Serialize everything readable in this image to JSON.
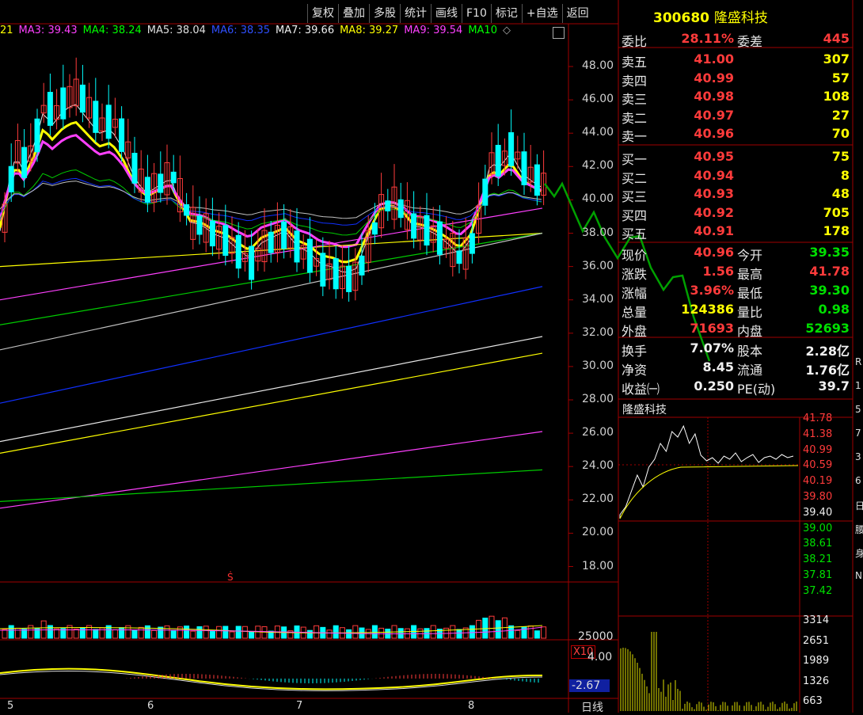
{
  "toolbar": [
    "复权",
    "叠加",
    "多股",
    "统计",
    "画线",
    "F10",
    "标记",
    "+自选",
    "返回"
  ],
  "stock": {
    "code": "300680",
    "name": "隆盛科技"
  },
  "ma_legend": [
    {
      "label": "21",
      "color": "#ffff00"
    },
    {
      "label": "MA3: 39.43",
      "color": "#ff40ff"
    },
    {
      "label": "MA4: 38.24",
      "color": "#00ff00"
    },
    {
      "label": "MA5: 38.04",
      "color": "#e0e0e0"
    },
    {
      "label": "MA6: 38.35",
      "color": "#3050ff"
    },
    {
      "label": "MA7: 39.66",
      "color": "#f0f0f0"
    },
    {
      "label": "MA8: 39.27",
      "color": "#ffff00"
    },
    {
      "label": "MA9: 39.54",
      "color": "#ff40ff"
    },
    {
      "label": "MA10",
      "color": "#00ff00"
    }
  ],
  "price_axis": [
    "48.00",
    "46.00",
    "44.00",
    "42.00",
    "40.00",
    "38.00",
    "36.00",
    "34.00",
    "32.00",
    "30.00",
    "28.00",
    "26.00",
    "24.00",
    "22.00",
    "20.00",
    "18.00"
  ],
  "volume_axis": {
    "label": "25000",
    "unit": "X10"
  },
  "macd_axis": {
    "top": "4.00",
    "current": "-2.67"
  },
  "months": [
    "5",
    "6",
    "7",
    "8"
  ],
  "period_label": "日线",
  "quote": {
    "weibi": {
      "label": "委比",
      "value": "28.11%",
      "label2": "委差",
      "value2": "445"
    },
    "asks": [
      {
        "label": "卖五",
        "price": "41.00",
        "vol": "307"
      },
      {
        "label": "卖四",
        "price": "40.99",
        "vol": "57"
      },
      {
        "label": "卖三",
        "price": "40.98",
        "vol": "108"
      },
      {
        "label": "卖二",
        "price": "40.97",
        "vol": "27"
      },
      {
        "label": "卖一",
        "price": "40.96",
        "vol": "70"
      }
    ],
    "bids": [
      {
        "label": "买一",
        "price": "40.95",
        "vol": "75"
      },
      {
        "label": "买二",
        "price": "40.94",
        "vol": "8"
      },
      {
        "label": "买三",
        "price": "40.93",
        "vol": "48"
      },
      {
        "label": "买四",
        "price": "40.92",
        "vol": "705"
      },
      {
        "label": "买五",
        "price": "40.91",
        "vol": "178"
      }
    ],
    "stats": [
      {
        "l1": "现价",
        "v1": "40.96",
        "c1": "red",
        "l2": "今开",
        "v2": "39.35",
        "c2": "green"
      },
      {
        "l1": "涨跌",
        "v1": "1.56",
        "c1": "red",
        "l2": "最高",
        "v2": "41.78",
        "c2": "red"
      },
      {
        "l1": "涨幅",
        "v1": "3.96%",
        "c1": "red",
        "l2": "最低",
        "v2": "39.30",
        "c2": "green"
      },
      {
        "l1": "总量",
        "v1": "124386",
        "c1": "yellow",
        "l2": "量比",
        "v2": "0.98",
        "c2": "green"
      },
      {
        "l1": "外盘",
        "v1": "71693",
        "c1": "red",
        "l2": "内盘",
        "v2": "52693",
        "c2": "green"
      }
    ],
    "stats2": [
      {
        "l1": "换手",
        "v1": "7.07%",
        "l2": "股本",
        "v2": "2.28亿"
      },
      {
        "l1": "净资",
        "v1": "8.45",
        "l2": "流通",
        "v2": "1.76亿"
      },
      {
        "l1": "收益㈠",
        "v1": "0.250",
        "l2": "PE(动)",
        "v2": "39.7"
      }
    ]
  },
  "intraday": {
    "title": "隆盛科技",
    "price_labels": [
      {
        "v": "41.78",
        "c": "red"
      },
      {
        "v": "41.38",
        "c": "red"
      },
      {
        "v": "40.99",
        "c": "red"
      },
      {
        "v": "40.59",
        "c": "red"
      },
      {
        "v": "40.19",
        "c": "red"
      },
      {
        "v": "39.80",
        "c": "red"
      },
      {
        "v": "39.40",
        "c": "white"
      },
      {
        "v": "39.00",
        "c": "green"
      },
      {
        "v": "38.61",
        "c": "green"
      },
      {
        "v": "38.21",
        "c": "green"
      },
      {
        "v": "37.81",
        "c": "green"
      },
      {
        "v": "37.42",
        "c": "green"
      }
    ],
    "vol_labels": [
      "3314",
      "2651",
      "1989",
      "1326",
      "663"
    ]
  },
  "right_edge": [
    "R",
    "1",
    "5",
    "7",
    "3",
    "6",
    "日",
    "腰",
    "身",
    "N"
  ],
  "colors": {
    "up": "#ff3b3b",
    "down": "#00ffff",
    "axis": "#b00000",
    "ma_yellow": "#ffff00",
    "ma_pink": "#ff40ff",
    "ma_blue": "#1030ff",
    "ma_green": "#00cc00",
    "ma_white": "#e6e6e6",
    "trend": "#00a000"
  }
}
